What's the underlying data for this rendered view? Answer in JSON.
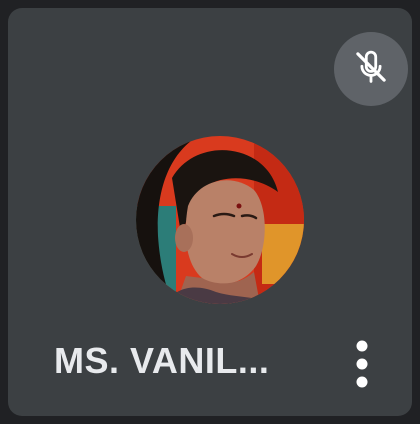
{
  "participant": {
    "name": "MS. VANIL...",
    "avatar": "participant-photo",
    "microphone": {
      "state": "muted",
      "icon": "mic-off-icon"
    }
  },
  "actions": {
    "more_icon": "more-vert-icon"
  },
  "colors": {
    "tile_background": "#3c4043",
    "mute_badge": "#5f6368",
    "text": "#e8eaed"
  }
}
